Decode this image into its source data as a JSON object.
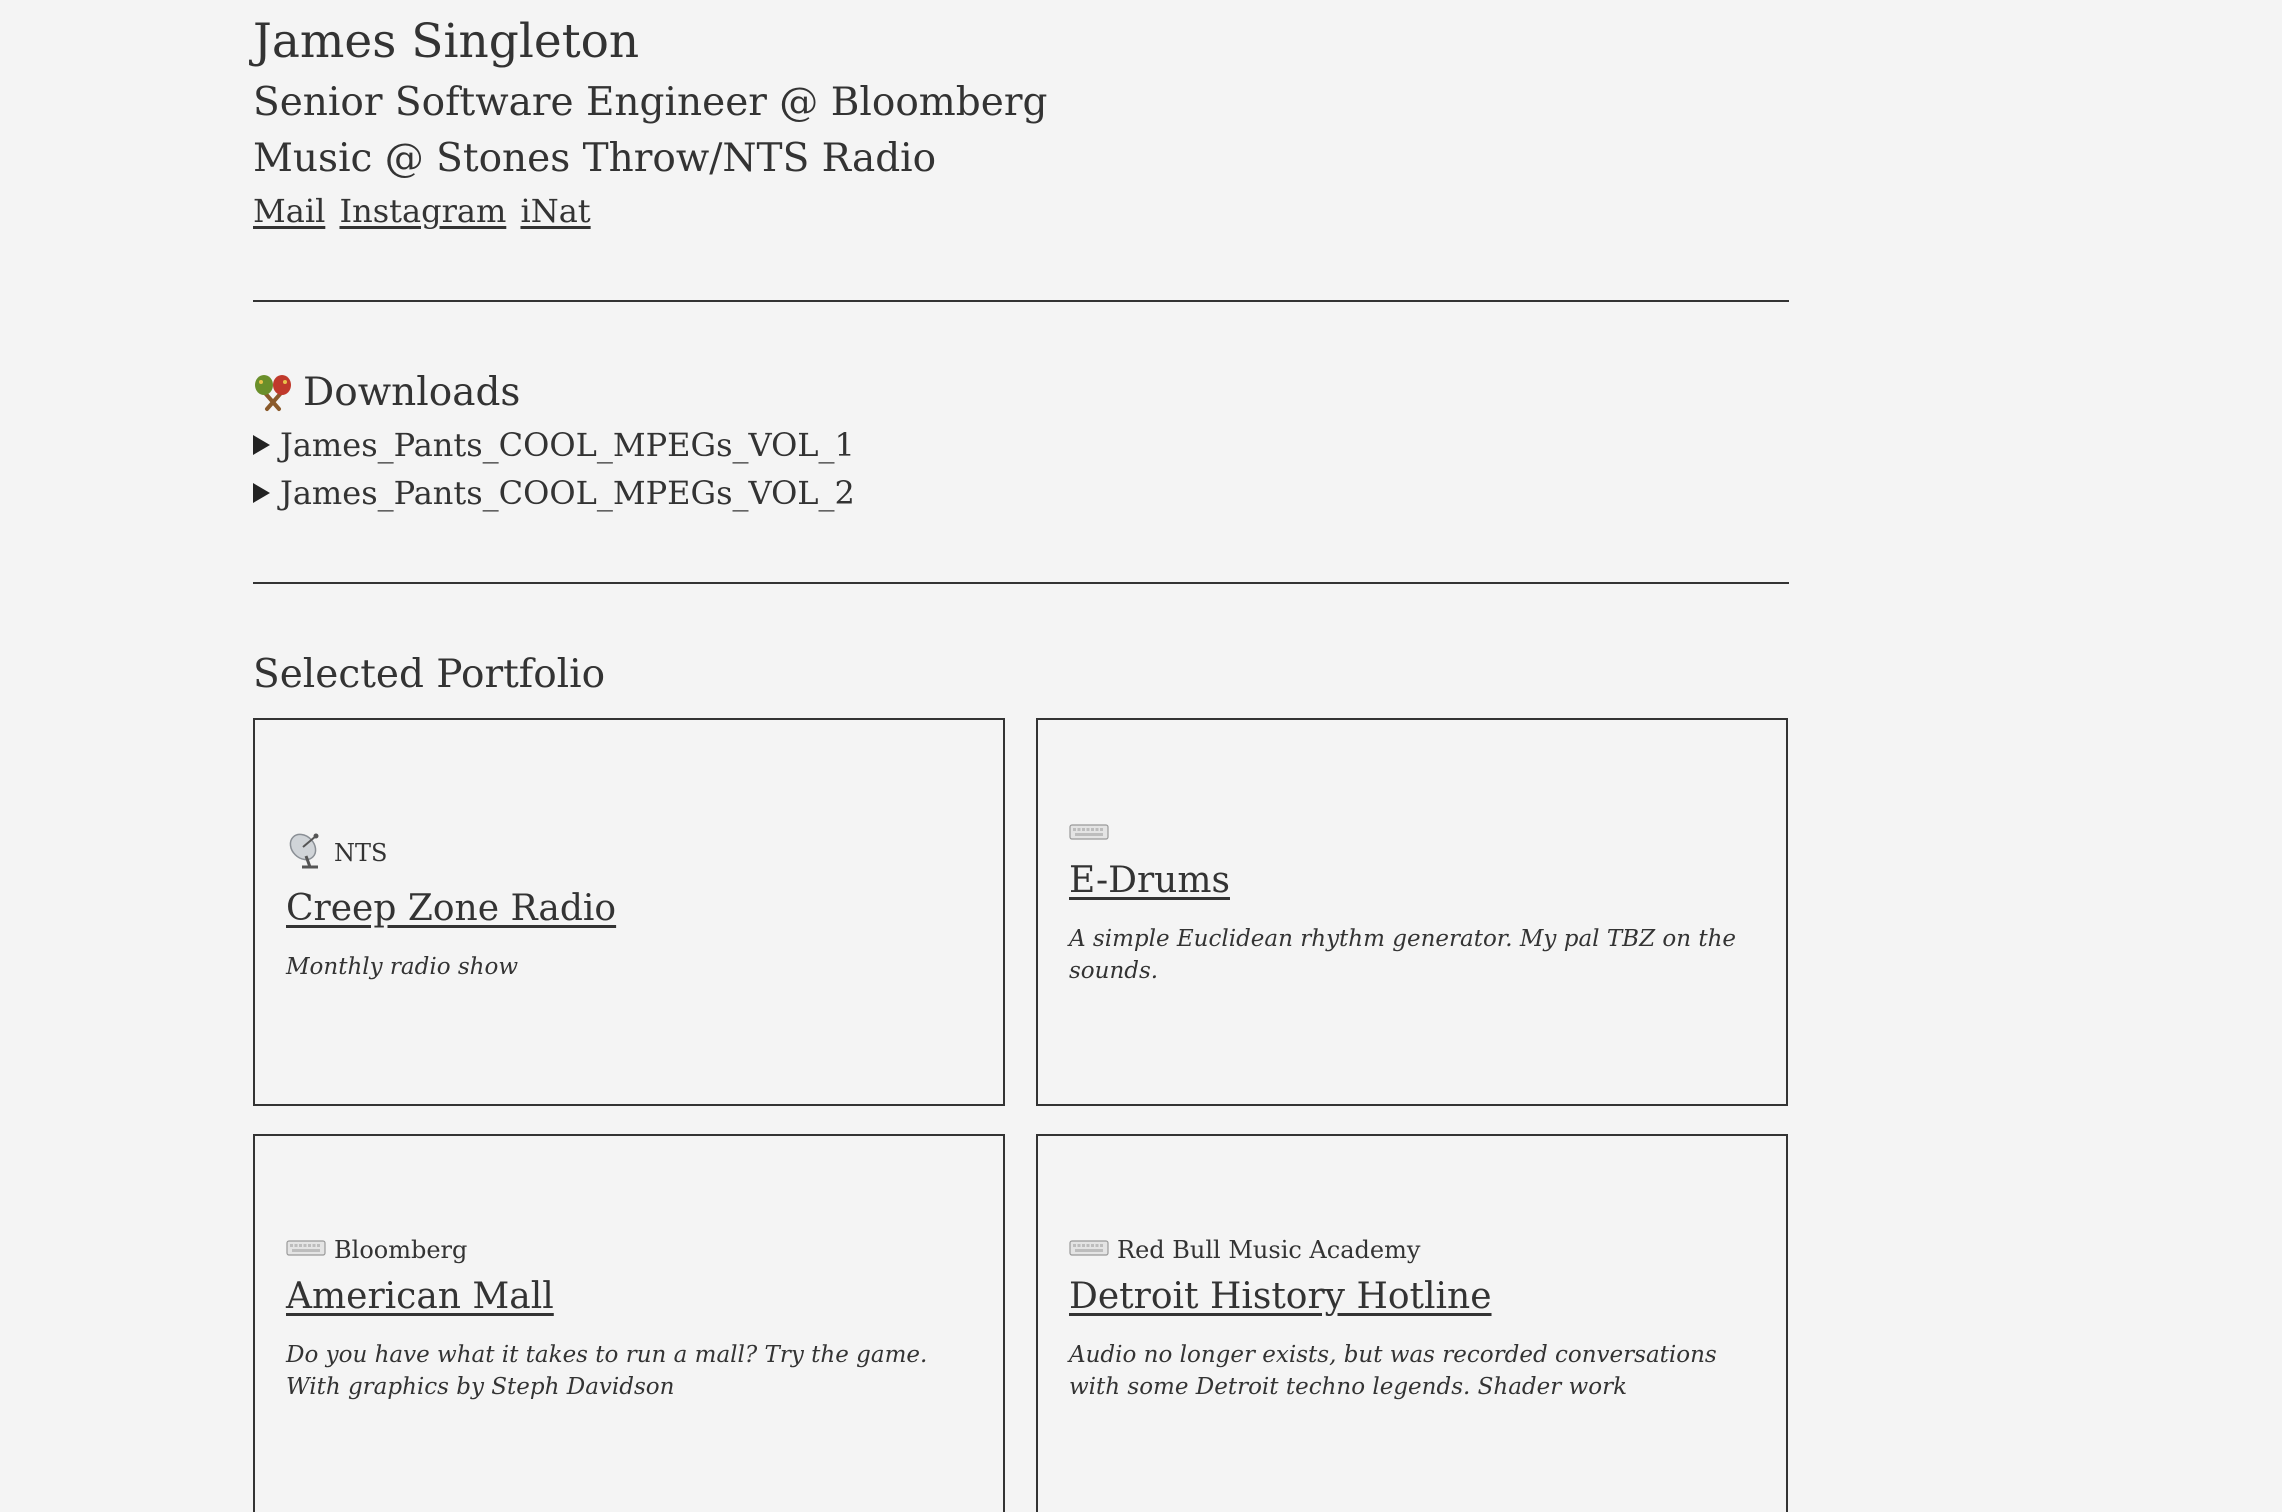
{
  "header": {
    "name": "James Singleton",
    "subtitle_1": "Senior Software Engineer @ Bloomberg",
    "subtitle_2": "Music @ Stones Throw/NTS Radio",
    "links": [
      "Mail",
      "Instagram",
      "iNat"
    ]
  },
  "downloads": {
    "heading": "Downloads",
    "icon": "maracas-icon",
    "items": [
      "James_Pants_COOL_MPEGs_VOL_1",
      "James_Pants_COOL_MPEGs_VOL_2"
    ]
  },
  "portfolio": {
    "heading": "Selected Portfolio",
    "cards": [
      {
        "icon": "satellite-dish-icon",
        "tag": "NTS",
        "title": "Creep Zone Radio",
        "description": "Monthly radio show"
      },
      {
        "icon": "keyboard-icon",
        "tag": "",
        "title": "E-Drums",
        "description": "A simple Euclidean rhythm generator. My pal TBZ on the sounds."
      },
      {
        "icon": "keyboard-icon",
        "tag": "Bloomberg",
        "title": "American Mall",
        "description": "Do you have what it takes to run a mall? Try the game. With graphics by Steph Davidson"
      },
      {
        "icon": "keyboard-icon",
        "tag": "Red Bull Music Academy",
        "title": "Detroit History Hotline",
        "description": "Audio no longer exists, but was recorded conversations with some Detroit techno legends. Shader work"
      }
    ]
  }
}
